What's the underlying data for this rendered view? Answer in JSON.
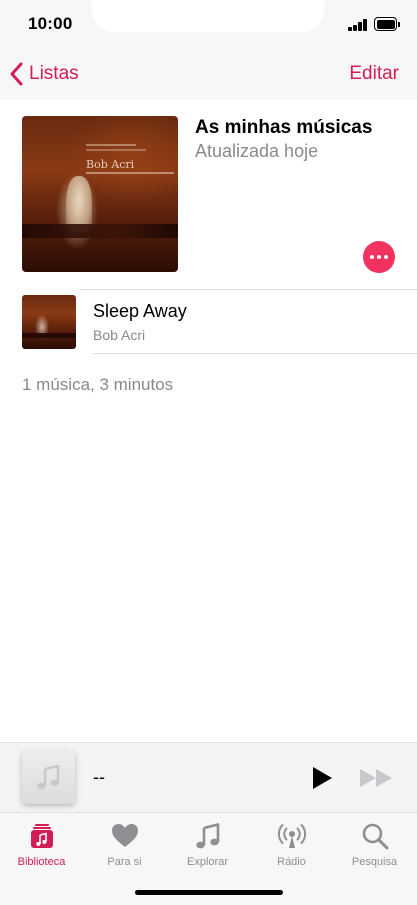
{
  "status_bar": {
    "time": "10:00"
  },
  "nav": {
    "back_label": "Listas",
    "edit_label": "Editar"
  },
  "playlist": {
    "title": "As minhas músicas",
    "subtitle": "Atualizada hoje",
    "artwork_text": "Bob Acri"
  },
  "tracks": [
    {
      "title": "Sleep Away",
      "artist": "Bob Acri"
    }
  ],
  "summary": "1 música, 3 minutos",
  "mini_player": {
    "title": "--"
  },
  "tabs": [
    {
      "label": "Biblioteca",
      "icon": "library-icon",
      "active": true
    },
    {
      "label": "Para si",
      "icon": "heart-icon",
      "active": false
    },
    {
      "label": "Explorar",
      "icon": "music-note-icon",
      "active": false
    },
    {
      "label": "Rádio",
      "icon": "radio-icon",
      "active": false
    },
    {
      "label": "Pesquisa",
      "icon": "search-icon",
      "active": false
    }
  ],
  "colors": {
    "accent": "#d21e55",
    "more_button": "#f2325f",
    "secondary_text": "#8a8a8e",
    "inactive_tab": "#8e8e93"
  }
}
